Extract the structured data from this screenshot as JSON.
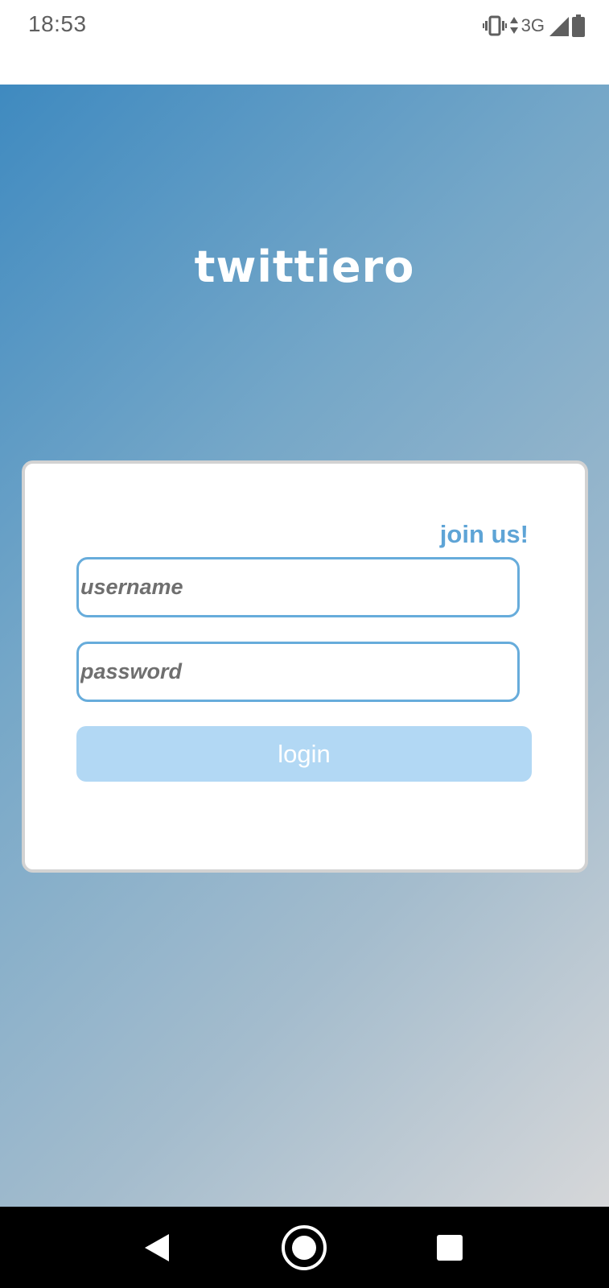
{
  "status_bar": {
    "time": "18:53",
    "network": "3G",
    "icons": [
      "vibrate-icon",
      "data-arrows-icon",
      "signal-icon",
      "battery-icon"
    ]
  },
  "app": {
    "logo_text": "twittiero",
    "join_link": "join us!",
    "username_placeholder": "username",
    "password_placeholder": "password",
    "login_label": "login"
  },
  "nav_bar": {
    "icons": [
      "back-icon",
      "home-icon",
      "recents-icon"
    ]
  },
  "colors": {
    "accent": "#5ea4d6",
    "field_border": "#67acdb",
    "login_button": "#b2d8f4",
    "gradient_start": "#3f8ac0",
    "gradient_end": "#d6d7d9"
  }
}
